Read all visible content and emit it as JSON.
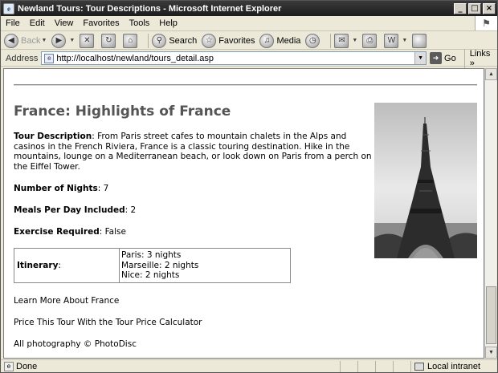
{
  "window": {
    "title": "Newland Tours: Tour Descriptions - Microsoft Internet Explorer",
    "controls": [
      "_",
      "□",
      "×"
    ]
  },
  "menu": [
    "File",
    "Edit",
    "View",
    "Favorites",
    "Tools",
    "Help"
  ],
  "toolbar": {
    "back_label": "Back",
    "search_label": "Search",
    "favorites_label": "Favorites",
    "media_label": "Media"
  },
  "address": {
    "label": "Address",
    "url": "http://localhost/newland/tours_detail.asp",
    "go_label": "Go",
    "links_label": "Links"
  },
  "page": {
    "title": "France: Highlights of France",
    "description_label": "Tour Description",
    "description_text": ": From Paris street cafes to mountain chalets in the Alps and casinos in the French Riviera, France is a classic touring destination. Hike in the mountains, lounge on a Mediterranean beach, or look down on Paris from a perch on the Eiffel Tower.",
    "nights_label": "Number of Nights",
    "nights_value": ": 7",
    "meals_label": "Meals Per Day Included",
    "meals_value": ": 2",
    "exercise_label": "Exercise Required",
    "exercise_value": ": False",
    "itinerary_label": "Itinerary",
    "itinerary_colon": ":",
    "itinerary": [
      "Paris: 3 nights",
      "Marseille: 2 nights",
      "Nice: 2 nights"
    ],
    "learn_more": "Learn More About France",
    "price_calc": "Price This Tour With the Tour Price Calculator",
    "credit": "All photography © PhotoDisc"
  },
  "status": {
    "text": "Done",
    "zone": "Local intranet"
  },
  "icons": {
    "app": "ie-icon",
    "photo": "eiffel-tower-photo"
  }
}
